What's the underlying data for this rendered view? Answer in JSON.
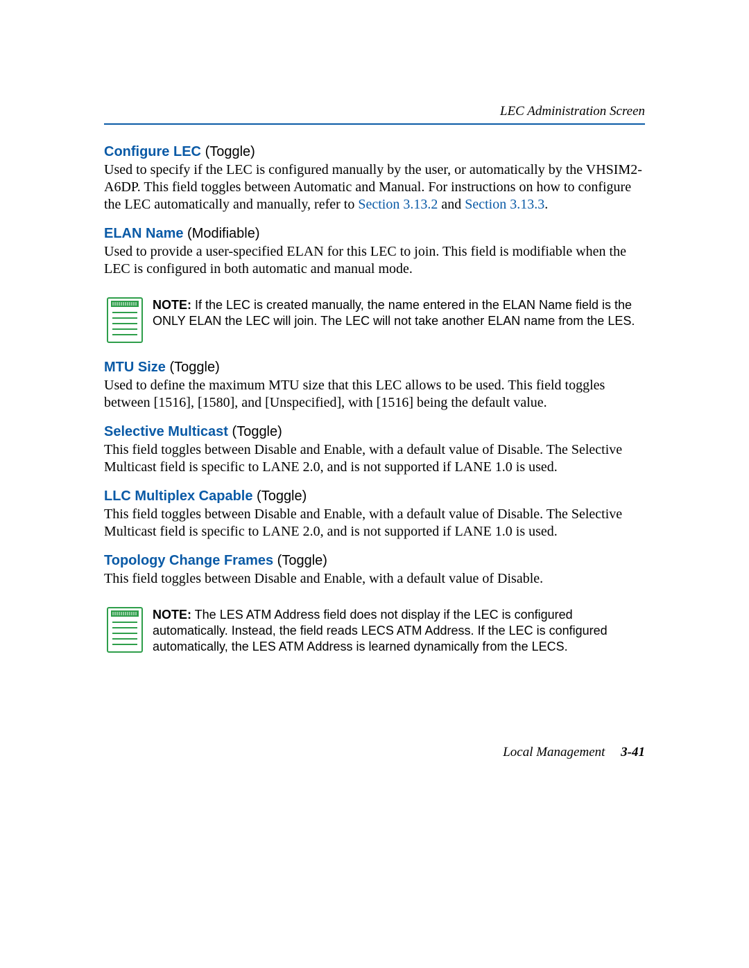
{
  "header": {
    "running_title": "LEC Administration Screen"
  },
  "sections": {
    "configure_lec": {
      "title": "Configure LEC",
      "paren": "(Toggle)",
      "body_pre": "Used to specify if the LEC is configured manually by the user, or automatically by the VHSIM2-A6DP. This field toggles between Automatic and Manual. For instructions on how to configure the LEC automatically and manually, refer to ",
      "xref1": "Section 3.13.2",
      "and": " and ",
      "xref2": "Section 3.13.3",
      "body_post": "."
    },
    "elan_name": {
      "title": "ELAN Name",
      "paren": "(Modifiable)",
      "body": "Used to provide a user-specified ELAN for this LEC to join. This field is modifiable when the LEC is configured in both automatic and manual mode."
    },
    "note1": {
      "label": "NOTE:",
      "text": "  If the LEC is created manually, the name entered in the ELAN Name field is the ONLY ELAN the LEC will join. The LEC will not take another ELAN name from the LES."
    },
    "mtu_size": {
      "title": "MTU Size",
      "paren": "(Toggle)",
      "body": "Used to define the maximum MTU size that this LEC allows to be used. This field toggles between [1516], [1580], and [Unspecified], with [1516] being the default value."
    },
    "selective_multicast": {
      "title": "Selective Multicast",
      "paren": "(Toggle)",
      "body": "This field toggles between Disable and Enable, with a default value of Disable. The Selective Multicast field is specific to LANE 2.0, and is not supported if LANE 1.0 is used."
    },
    "llc_multiplex": {
      "title": "LLC Multiplex Capable",
      "paren": "(Toggle)",
      "body": "This field toggles between Disable and Enable, with a default value of Disable. The Selective Multicast field is specific to LANE 2.0, and is not supported if LANE 1.0 is used."
    },
    "topology_change": {
      "title": "Topology Change Frames",
      "paren": "(Toggle)",
      "body": "This field toggles between Disable and Enable, with a default value of Disable."
    },
    "note2": {
      "label": "NOTE:",
      "text": "  The LES ATM Address field does not display if the LEC is configured automatically. Instead, the field reads LECS ATM Address. If the LEC is configured automatically, the LES ATM Address is learned dynamically from the LECS."
    }
  },
  "footer": {
    "chapter": "Local Management",
    "page": "3-41"
  }
}
